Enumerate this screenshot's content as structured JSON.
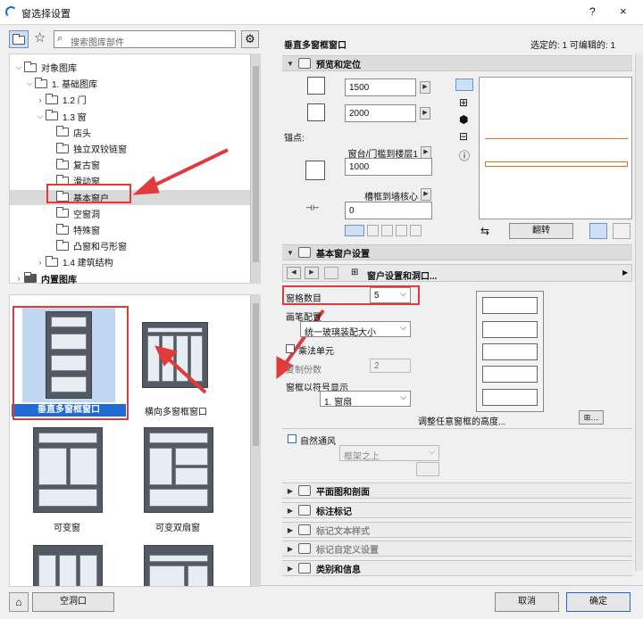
{
  "window": {
    "title": "窗选择设置",
    "help": "?",
    "close": "×"
  },
  "left": {
    "search_placeholder": "搜索图库部件",
    "tree": [
      {
        "label": "对象图库",
        "indent": 0,
        "arrow": "⌵",
        "dark": false
      },
      {
        "label": "1. 基础图库",
        "indent": 1,
        "arrow": "⌵",
        "dark": false
      },
      {
        "label": "1.2 门",
        "indent": 2,
        "arrow": "›",
        "dark": false
      },
      {
        "label": "1.3 窗",
        "indent": 2,
        "arrow": "⌵",
        "dark": false
      },
      {
        "label": "店头",
        "indent": 3,
        "arrow": "",
        "dark": false
      },
      {
        "label": "独立双铰链窗",
        "indent": 3,
        "arrow": "",
        "dark": false
      },
      {
        "label": "复古窗",
        "indent": 3,
        "arrow": "",
        "dark": false
      },
      {
        "label": "滑动窗",
        "indent": 3,
        "arrow": "",
        "dark": false
      },
      {
        "label": "基本窗户",
        "indent": 3,
        "arrow": "",
        "dark": false,
        "selected": true
      },
      {
        "label": "空窗洞",
        "indent": 3,
        "arrow": "",
        "dark": false
      },
      {
        "label": "特殊窗",
        "indent": 3,
        "arrow": "",
        "dark": false
      },
      {
        "label": "凸窗和弓形窗",
        "indent": 3,
        "arrow": "",
        "dark": false
      },
      {
        "label": "1.4 建筑结构",
        "indent": 2,
        "arrow": "›",
        "dark": false
      },
      {
        "label": "内置图库",
        "indent": 0,
        "arrow": "›",
        "dark": true
      }
    ],
    "thumbs": [
      {
        "caption": "垂直多窗框窗口",
        "selected": true
      },
      {
        "caption": "横向多窗框窗口",
        "selected": false
      },
      {
        "caption": "可变窗",
        "selected": false
      },
      {
        "caption": "可变双扇窗",
        "selected": false
      }
    ],
    "empty_opening_button": "空洞口"
  },
  "header": {
    "title": "垂直多窗框窗口",
    "selected_info": "选定的: 1 可编辑的: 1"
  },
  "preview": {
    "section": "预览和定位",
    "width": "1500",
    "height": "2000",
    "anchor_label": "锚点:",
    "sill_label": "窗台/门槛到楼层1",
    "sill_value": "1000",
    "reveal_label": "槽框到墙核心",
    "reveal_value": "0",
    "flip_button": "翻转"
  },
  "basic": {
    "section": "基本窗户设置",
    "nav_label": "窗户设置和洞口...",
    "panes_label": "窗格数目",
    "panes_value": "5",
    "pen_label": "画笔配置",
    "pen_value": "统一玻璃装配大小",
    "mult_label": "乘法单元",
    "copies_label": "复制份数",
    "copies_value": "2",
    "symbol_label": "窗框以符号显示",
    "symbol_value": "1. 窗扇",
    "adjust_label": "调整任意窗框的高度..."
  },
  "vent": {
    "label": "自然通风",
    "position_value": "框架之上"
  },
  "sections": [
    {
      "label": "平面图和剖面",
      "dim": false
    },
    {
      "label": "标注标记",
      "dim": false
    },
    {
      "label": "标记文本样式",
      "dim": true
    },
    {
      "label": "标记自定义设置",
      "dim": true
    },
    {
      "label": "类别和信息",
      "dim": false
    }
  ],
  "footer": {
    "cancel": "取消",
    "ok": "确定"
  },
  "colors": {
    "annotation": "#e03a3a",
    "selection": "#1e6bd6",
    "wall_line": "#e07020"
  }
}
